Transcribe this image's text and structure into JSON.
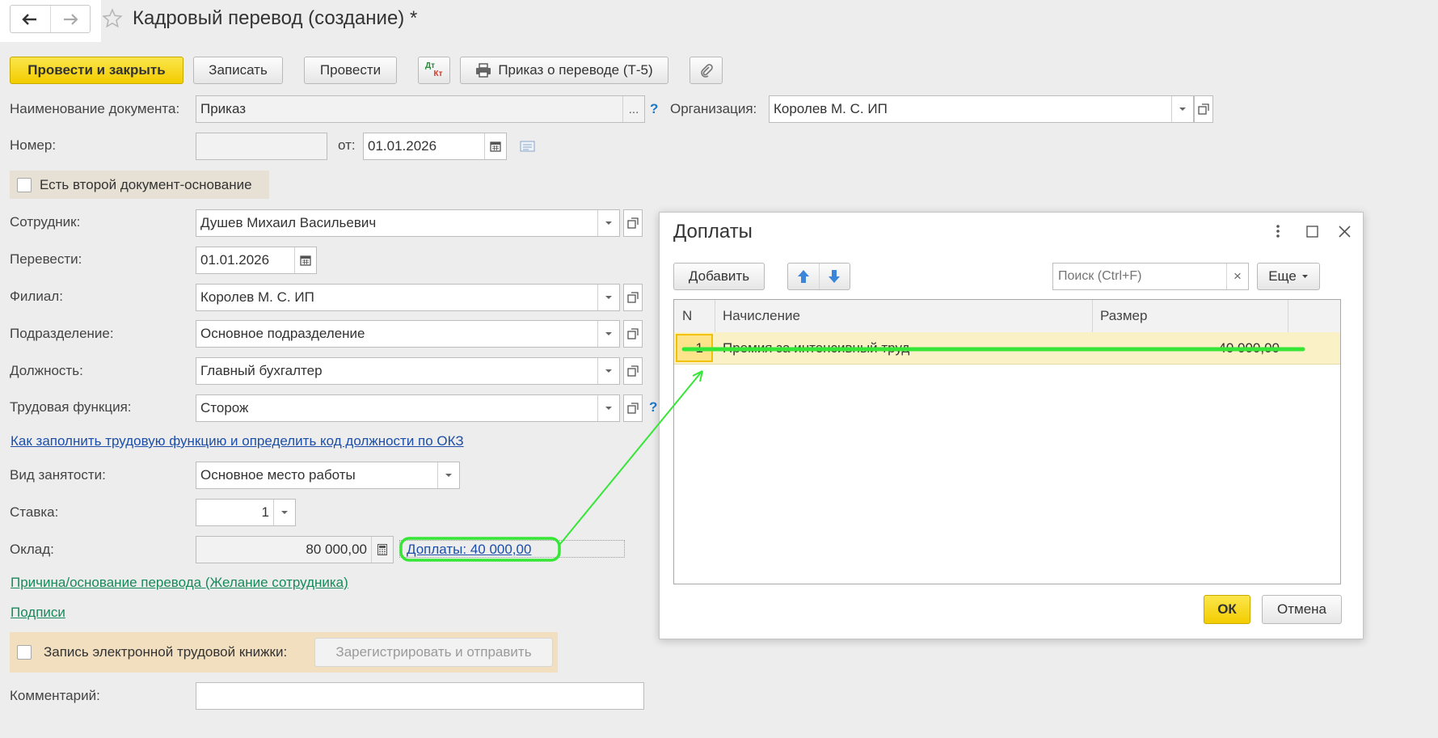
{
  "header": {
    "title": "Кадровый перевод (создание) *"
  },
  "toolbar": {
    "post_close": "Провести и закрыть",
    "save": "Записать",
    "post": "Провести",
    "dt": "Дт",
    "kt": "Кт",
    "print_order": "Приказ о переводе (Т-5)"
  },
  "form": {
    "doc_name_label": "Наименование документа:",
    "doc_name_value": "Приказ",
    "ellipsis": "...",
    "help": "?",
    "org_label": "Организация:",
    "org_value": "Королев М. С. ИП",
    "number_label": "Номер:",
    "number_value": "",
    "from_label": "от:",
    "from_value": "01.01.2026",
    "second_doc_label": "Есть второй документ-основание",
    "employee_label": "Сотрудник:",
    "employee_value": "Душев Михаил Васильевич",
    "transfer_label": "Перевести:",
    "transfer_value": "01.01.2026",
    "branch_label": "Филиал:",
    "branch_value": "Королев М. С. ИП",
    "division_label": "Подразделение:",
    "division_value": "Основное подразделение",
    "position_label": "Должность:",
    "position_value": "Главный бухгалтер",
    "labor_function_label": "Трудовая функция:",
    "labor_function_value": "Сторож",
    "okz_link": "Как заполнить трудовую функцию и определить код должности по ОКЗ",
    "employment_label": "Вид занятости:",
    "employment_value": "Основное место работы",
    "rate_label": "Ставка:",
    "rate_value": "1",
    "salary_label": "Оклад:",
    "salary_value": "80 000,00",
    "allowances_link": "Доплаты: 40 000,00",
    "reason_link": "Причина/основание перевода (Желание сотрудника)",
    "signatures_link": "Подписи",
    "etk_label": "Запись электронной трудовой книжки:",
    "etk_button": "Зарегистрировать и отправить",
    "comment_label": "Комментарий:",
    "comment_value": ""
  },
  "dialog": {
    "title": "Доплаты",
    "add_button": "Добавить",
    "search_placeholder": "Поиск (Ctrl+F)",
    "clear": "×",
    "more_button": "Еще",
    "columns": {
      "n": "N",
      "accrual": "Начисление",
      "size": "Размер"
    },
    "rows": [
      {
        "n": "1",
        "accrual": "Премия за интенсивный труд",
        "size": "40 000,00"
      }
    ],
    "ok_button": "ОК",
    "cancel_button": "Отмена"
  },
  "colors": {
    "primary": "#f5d000",
    "link_blue": "#1d4fa8",
    "link_green": "#178a5b",
    "annotation": "#36e636",
    "row_highlight": "#fbf1c6"
  }
}
